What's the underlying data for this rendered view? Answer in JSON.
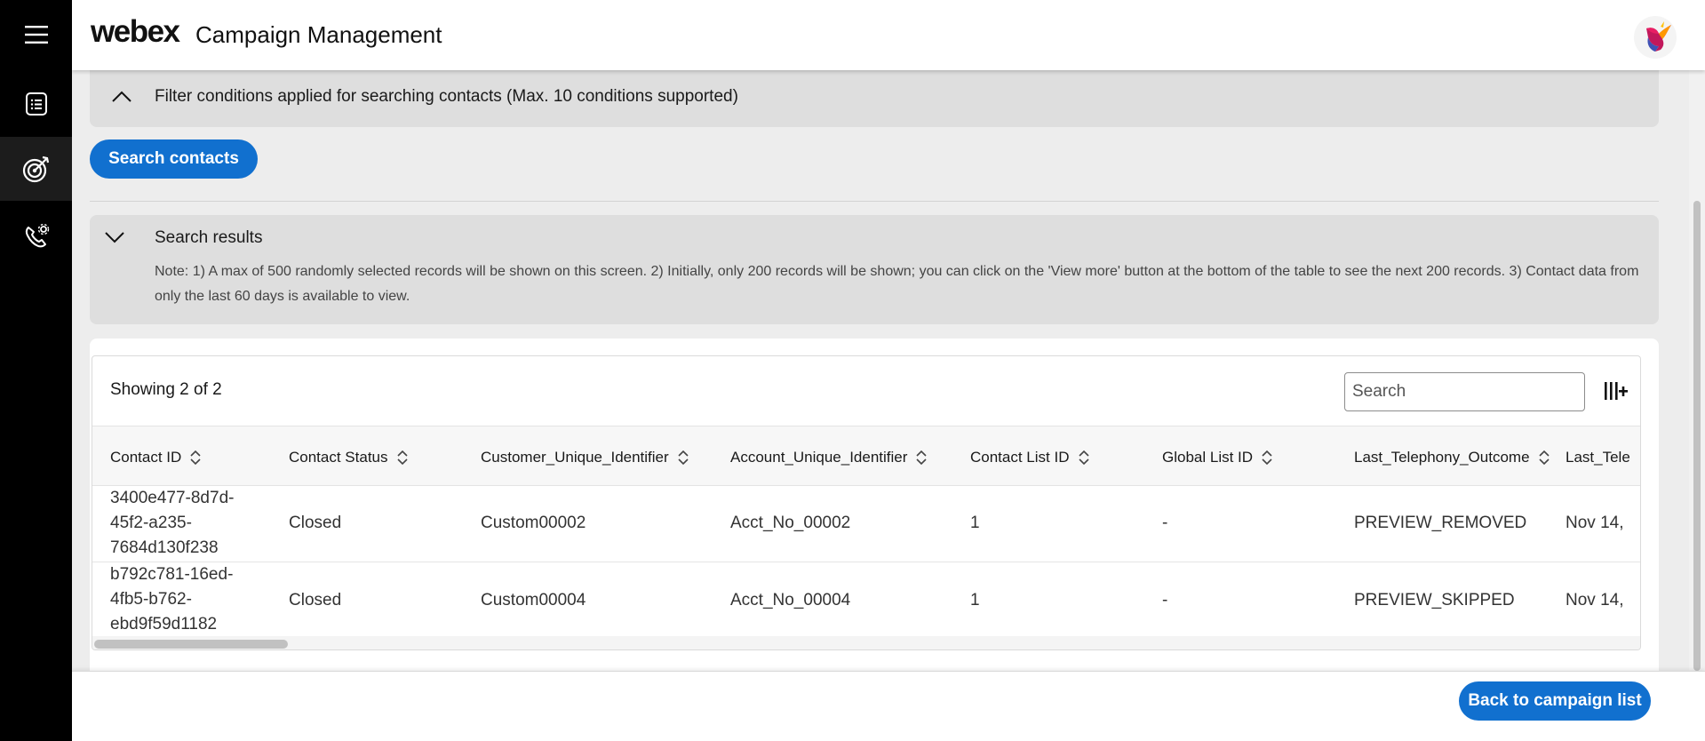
{
  "app": {
    "logo": "webex",
    "title": "Campaign Management"
  },
  "sidebar": {
    "items": [
      {
        "icon": "menu-icon"
      },
      {
        "icon": "list-icon"
      },
      {
        "icon": "target-icon",
        "active": true
      },
      {
        "icon": "phone-settings-icon"
      }
    ]
  },
  "filter": {
    "title": "Filter conditions applied for searching contacts (Max. 10 conditions supported)",
    "expanded": false
  },
  "search_button": "Search contacts",
  "results": {
    "title": "Search results",
    "note": "Note: 1) A max of 500 randomly selected records will be shown on this screen. 2) Initially, only 200 records will be shown; you can click on the 'View more' button at the bottom of the table to see the next 200 records. 3) Contact data from only the last 60 days is available to view."
  },
  "table": {
    "showing": "Showing 2 of 2",
    "search_placeholder": "Search",
    "columns": [
      "Contact ID",
      "Contact Status",
      "Customer_Unique_Identifier",
      "Account_Unique_Identifier",
      "Contact List ID",
      "Global List ID",
      "Last_Telephony_Outcome",
      "Last_Tele"
    ],
    "rows": [
      [
        "3400e477-8d7d-45f2-a235-7684d130f238",
        "Closed",
        "Custom00002",
        "Acct_No_00002",
        "1",
        "-",
        "PREVIEW_REMOVED",
        "Nov 14,"
      ],
      [
        "b792c781-16ed-4fb5-b762-ebd9f59d1182",
        "Closed",
        "Custom00004",
        "Acct_No_00004",
        "1",
        "-",
        "PREVIEW_SKIPPED",
        "Nov 14,"
      ]
    ]
  },
  "footer": {
    "back_button": "Back to campaign list"
  },
  "colors": {
    "primary": "#1170cf",
    "sidebar": "#000000",
    "panel": "#dedede",
    "background": "#ededed"
  }
}
